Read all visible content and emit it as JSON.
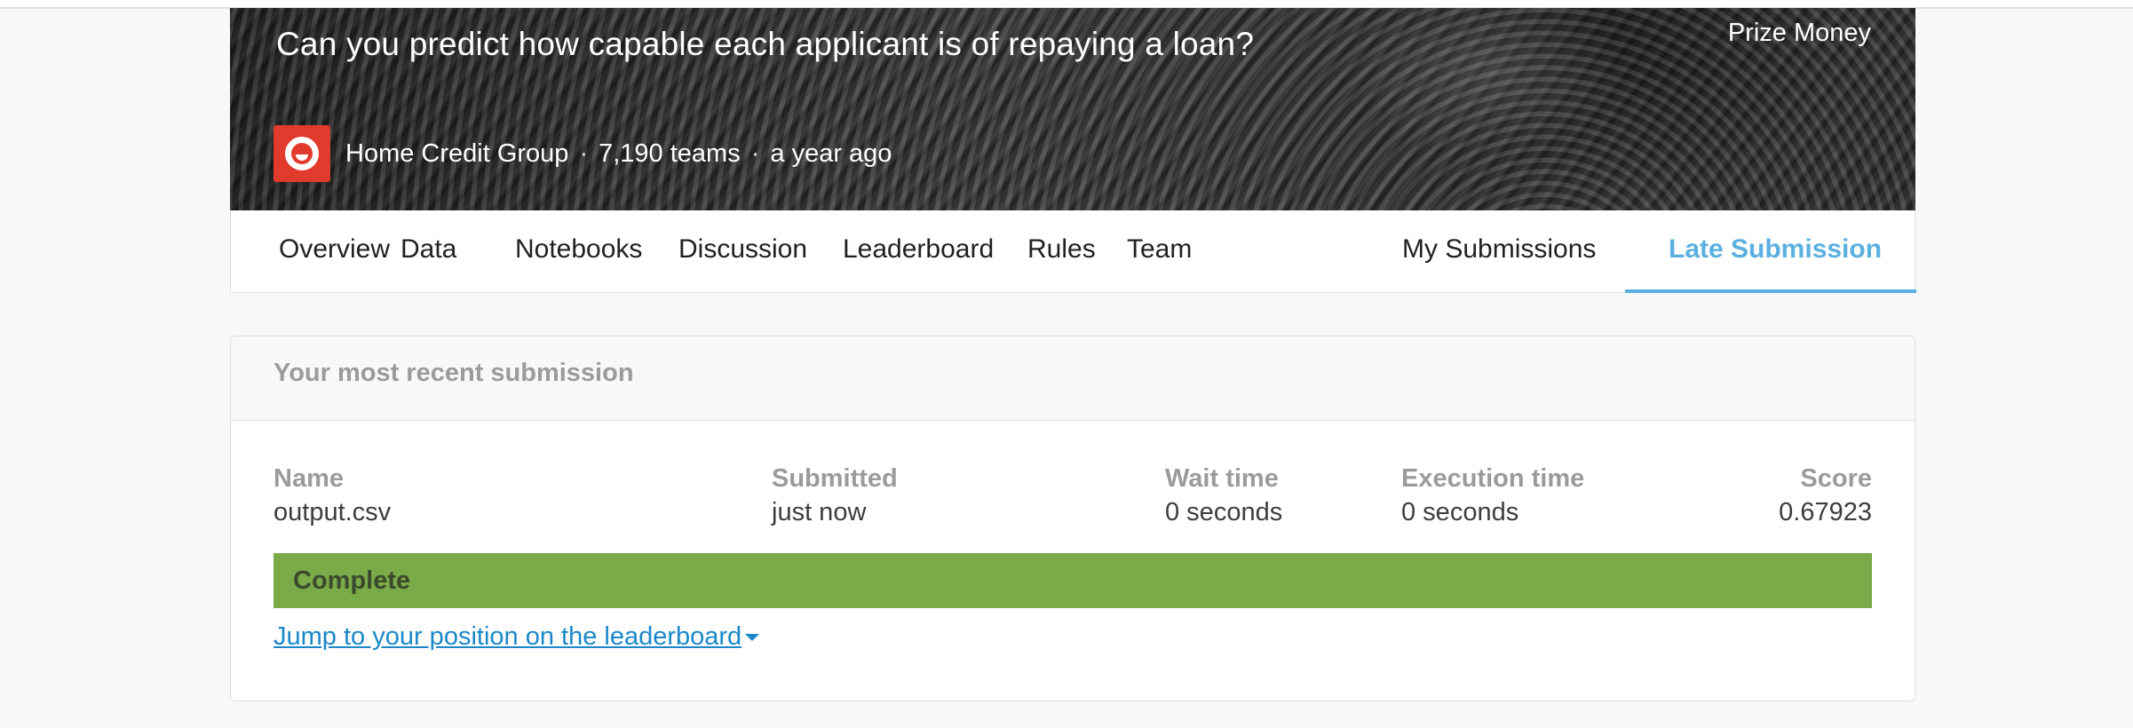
{
  "competition": {
    "title": "Can you predict how capable each applicant is of repaying a loan?",
    "prize_label": "Prize Money",
    "host": "Home Credit Group",
    "separator": "·",
    "teams": "7,190 teams",
    "age": "a year ago"
  },
  "tabs": {
    "overview": "Overview",
    "data": "Data",
    "notebooks": "Notebooks",
    "discussion": "Discussion",
    "leaderboard": "Leaderboard",
    "rules": "Rules",
    "team": "Team",
    "my_submissions": "My Submissions",
    "late_submission": "Late Submission"
  },
  "submission": {
    "heading": "Your most recent submission",
    "columns": {
      "name": {
        "label": "Name",
        "value": "output.csv"
      },
      "submitted": {
        "label": "Submitted",
        "value": "just now"
      },
      "wait_time": {
        "label": "Wait time",
        "value": "0 seconds"
      },
      "execution_time": {
        "label": "Execution time",
        "value": "0 seconds"
      },
      "score": {
        "label": "Score",
        "value": "0.67923"
      }
    },
    "status": "Complete",
    "status_color": "#7aab48",
    "jump_link": "Jump to your position on the leaderboard"
  },
  "colors": {
    "accent": "#5ab0e0",
    "link": "#1a88c8",
    "logo": "#e23b2e"
  }
}
